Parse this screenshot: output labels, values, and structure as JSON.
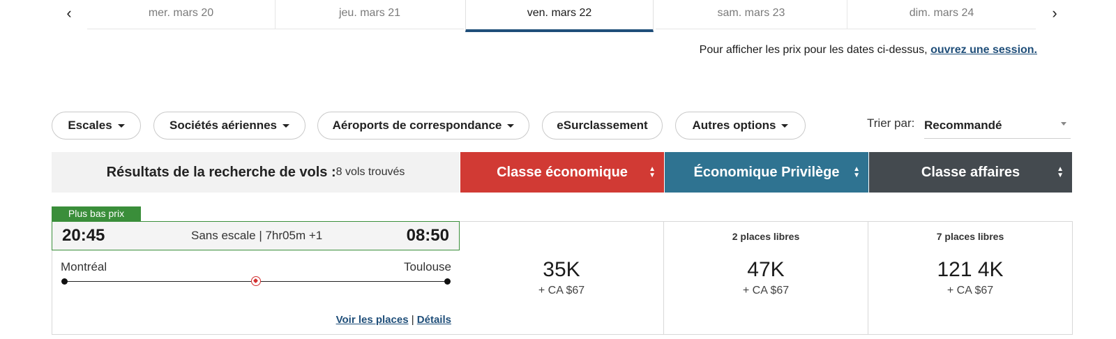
{
  "date_nav": {
    "prev_icon": "chevron-left",
    "next_icon": "chevron-right",
    "dates": [
      {
        "label": "mer. mars 20"
      },
      {
        "label": "jeu. mars 21"
      },
      {
        "label": "ven. mars 22",
        "active": true
      },
      {
        "label": "sam. mars 23"
      },
      {
        "label": "dim. mars 24"
      }
    ]
  },
  "login_notice": {
    "text": "Pour afficher les prix pour les dates ci-dessus,",
    "link": "ouvrez une session."
  },
  "filters": {
    "stops": "Escales",
    "airlines": "Sociétés aériennes",
    "connections": "Aéroports de correspondance",
    "upgrade": "eSurclassement",
    "more": "Autres options"
  },
  "sort": {
    "label": "Trier par:",
    "value": "Recommandé"
  },
  "results": {
    "title": "Résultats de la recherche de vols :",
    "count": "8 vols trouvés"
  },
  "cabins": {
    "economy": "Classe économique",
    "premium": "Économique Privilège",
    "business": "Classe affaires"
  },
  "colors": {
    "economy": "#d13a34",
    "premium": "#2f7391",
    "business": "#444a4f",
    "badge": "#3a8e3a",
    "link": "#1f4e79"
  },
  "flight": {
    "badge": "Plus bas prix",
    "depart_time": "20:45",
    "arrive_time": "08:50",
    "duration": "Sans escale | 7hr05m +1",
    "origin": "Montréal",
    "destination": "Toulouse",
    "airline_icon": "maple-leaf-logo",
    "seats_link": "Voir les places",
    "separator": "|",
    "details_link": "Détails",
    "fares": [
      {
        "seats": "",
        "points": "35K",
        "tax": "+ CA $67"
      },
      {
        "seats": "2 places libres",
        "points": "47K",
        "tax": "+ CA $67"
      },
      {
        "seats": "7 places libres",
        "points": "121 4K",
        "tax": "+ CA $67"
      }
    ]
  }
}
